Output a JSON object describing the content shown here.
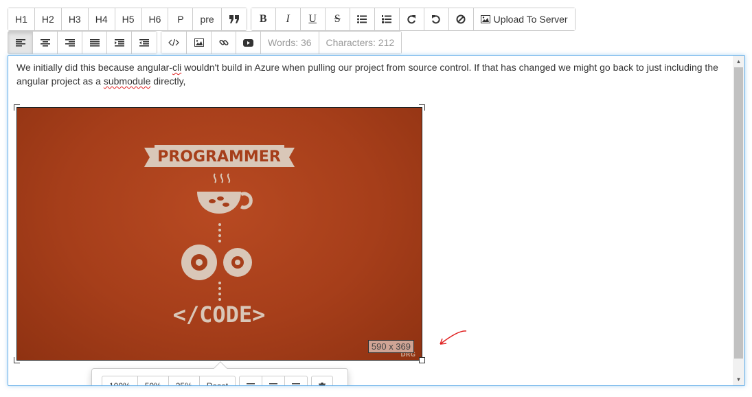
{
  "toolbar": {
    "style_buttons": [
      "H1",
      "H2",
      "H3",
      "H4",
      "H5",
      "H6",
      "P",
      "pre"
    ],
    "format_buttons": [
      "B",
      "I",
      "U",
      "S"
    ],
    "upload_label": "Upload To Server",
    "words_label": "Words: 36",
    "characters_label": "Characters: 212"
  },
  "editor": {
    "text_part1": "We initially did this because angular-",
    "text_cli": "cli",
    "text_part2": " wouldn't build in Azure when pulling our project from source control. If that has changed we might go back to just including the angular project as a ",
    "text_submodule": "submodule",
    "text_part3": " directly,"
  },
  "image": {
    "title_text": "PROGRAMMER",
    "code_text": "</CODE>",
    "dimensions": "590 x 369",
    "watermark": "DRG"
  },
  "image_popover": {
    "size_buttons": [
      "100%",
      "50%",
      "25%",
      "Reset"
    ]
  },
  "colors": {
    "image_background": "#a63e1a",
    "image_artwork": "#d9c7b8",
    "annotation_arrow": "#e02020",
    "focus_border": "#66afe9"
  }
}
